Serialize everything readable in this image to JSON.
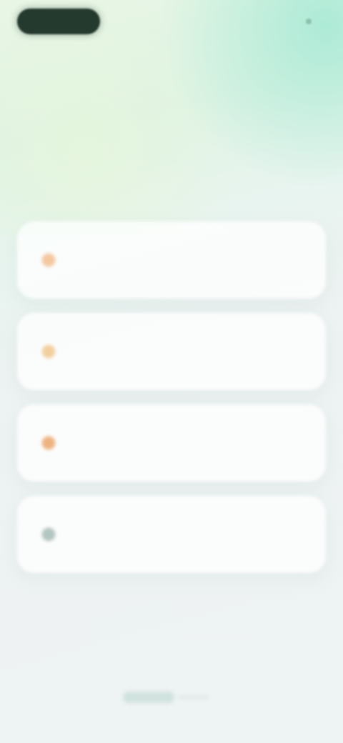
{
  "top_bar": {
    "left_pill_label": "",
    "right_status_label": ""
  },
  "question": {
    "text": ""
  },
  "options": [
    {
      "label": "",
      "icon": "star-icon"
    },
    {
      "label": "",
      "icon": "spark-icon"
    },
    {
      "label": "",
      "icon": "flame-icon"
    },
    {
      "label": "",
      "icon": "dot-icon"
    }
  ],
  "colors": {
    "accent_dark": "#253a2f",
    "accent_light": "#aaeed6",
    "card_background": "#ffffff",
    "text_primary": "#233b31",
    "text_secondary": "#546a62"
  }
}
